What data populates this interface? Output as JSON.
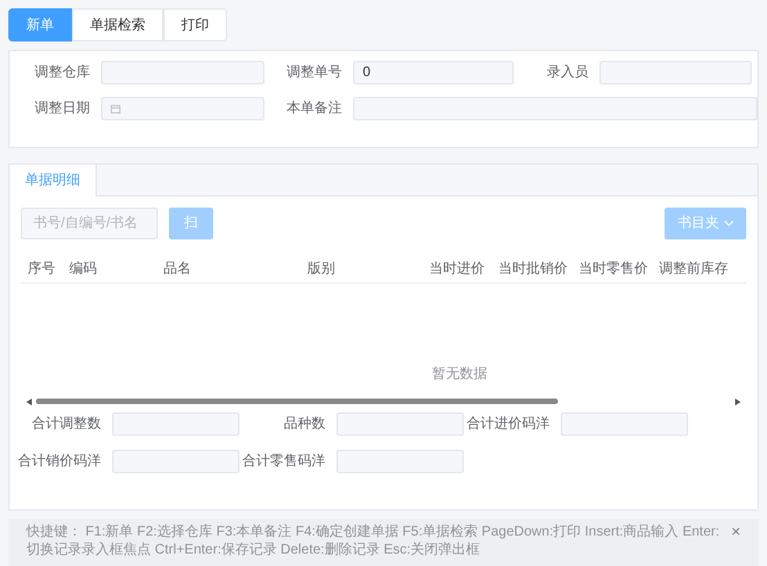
{
  "tabs": [
    {
      "label": "新单",
      "selected": true
    },
    {
      "label": "单据检索",
      "selected": false
    },
    {
      "label": "打印",
      "selected": false
    }
  ],
  "header_form": {
    "warehouse": {
      "label": "调整仓库"
    },
    "order_no": {
      "label": "调整单号",
      "value": "0"
    },
    "clerk": {
      "label": "录入员"
    },
    "date": {
      "label": "调整日期"
    },
    "remark": {
      "label": "本单备注"
    }
  },
  "detail": {
    "tabs": [
      {
        "label": "单据明细",
        "selected": true
      }
    ],
    "search": {
      "placeholder": "书号/自编号/书名"
    },
    "scan_button": "扫",
    "catalog_button": "书目夹",
    "table": {
      "columns": [
        "序号",
        "编码",
        "品名",
        "版别",
        "当时进价",
        "当时批销价",
        "当时零售价",
        "调整前库存"
      ],
      "empty_text": "暂无数据"
    },
    "totals": [
      {
        "label": "合计调整数"
      },
      {
        "label": "品种数"
      },
      {
        "label": "合计进价码洋"
      },
      {
        "label": "合计销价码洋"
      },
      {
        "label": "合计零售码洋"
      }
    ]
  },
  "shortcuts": {
    "text": "快捷键：  F1:新单 F2:选择仓库 F3:本单备注 F4:确定创建单据 F5:单据检索 PageDown:打印 Insert:商品输入 Enter:切换记录录入框焦点 Ctrl+Enter:保存记录 Delete:删除记录 Esc:关闭弹出框",
    "close": "×"
  }
}
